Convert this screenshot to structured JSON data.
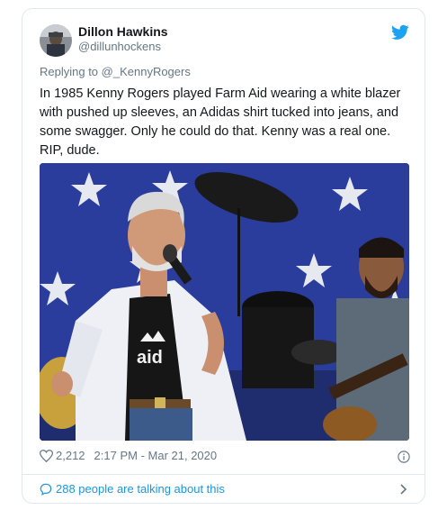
{
  "author": {
    "name": "Dillon Hawkins",
    "handle": "@dillunhockens"
  },
  "reply": {
    "prefix": "Replying to ",
    "mention": "@_KennyRogers"
  },
  "tweet": {
    "text": "In 1985 Kenny Rogers played Farm Aid wearing a white blazer with pushed up sleeves, an Adidas shirt tucked into jeans, and some swagger. Only he could do that. Kenny was a real one. RIP, dude."
  },
  "meta": {
    "likes": "2,212",
    "timestamp": "2:17 PM - Mar 21, 2020"
  },
  "footer": {
    "conversation": "288 people are talking about this"
  },
  "media": {
    "shirt_text": "aid"
  },
  "colors": {
    "twitter_blue": "#1da1f2",
    "link_blue": "#1b95e0",
    "muted": "#657786",
    "border": "#e1e8ed"
  },
  "icons": [
    "twitter-logo-icon",
    "heart-icon",
    "info-icon",
    "chat-bubble-icon",
    "chevron-right-icon"
  ]
}
